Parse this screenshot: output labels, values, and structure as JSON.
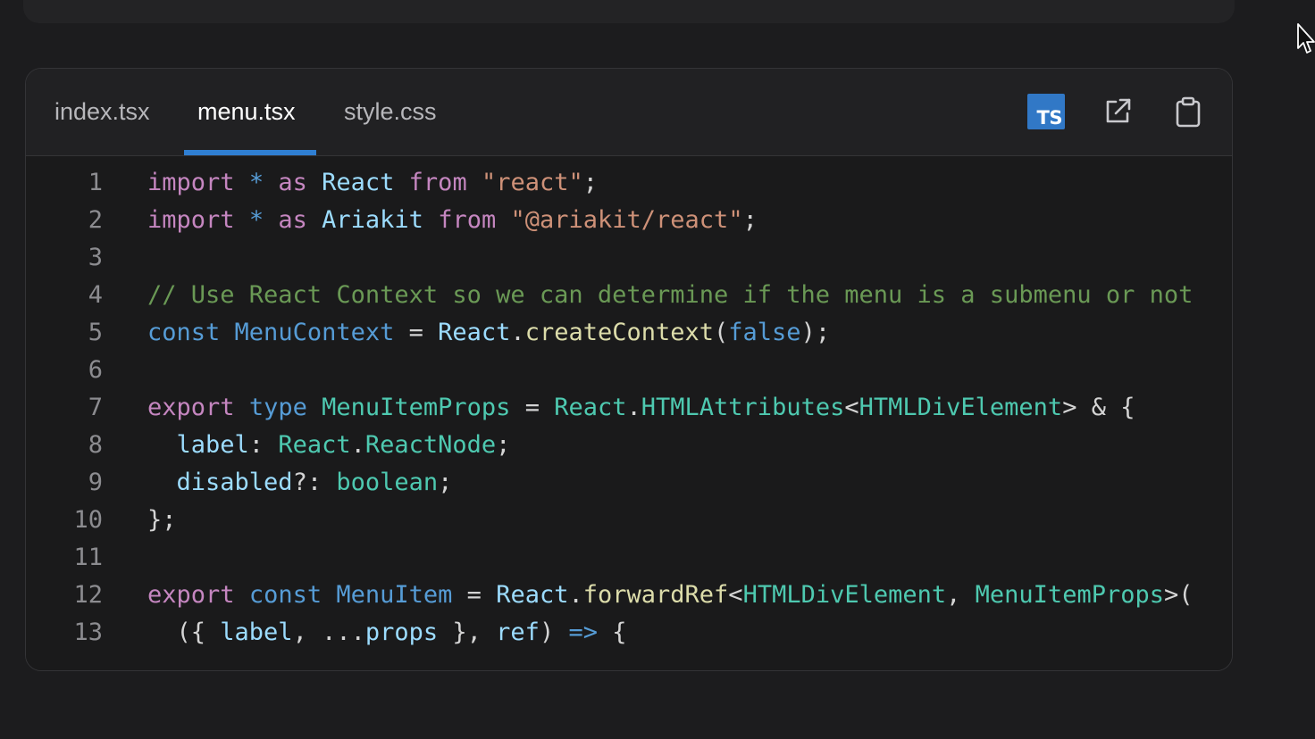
{
  "editor": {
    "tabs": [
      {
        "label": "index.tsx",
        "active": false
      },
      {
        "label": "menu.tsx",
        "active": true
      },
      {
        "label": "style.css",
        "active": false
      }
    ],
    "ts_badge": "TS",
    "icons": [
      "typescript-badge-icon",
      "open-external-icon",
      "clipboard-icon"
    ],
    "colors": {
      "keyword": "#c586c0",
      "declaration": "#569cd6",
      "identifier": "#9cdcfe",
      "type": "#4ec9b0",
      "function": "#dcdcaa",
      "string": "#ce9178",
      "comment": "#6a9955",
      "plain": "#d4d4d4",
      "accent": "#2f7fd3"
    }
  },
  "code": {
    "lines": [
      {
        "n": "1",
        "tokens": [
          [
            "import",
            "keyword"
          ],
          [
            " ",
            "plain"
          ],
          [
            "*",
            "declaration"
          ],
          [
            " ",
            "plain"
          ],
          [
            "as",
            "keyword"
          ],
          [
            " ",
            "plain"
          ],
          [
            "React",
            "identifier"
          ],
          [
            " ",
            "plain"
          ],
          [
            "from",
            "keyword"
          ],
          [
            " ",
            "plain"
          ],
          [
            "\"react\"",
            "string"
          ],
          [
            ";",
            "plain"
          ]
        ]
      },
      {
        "n": "2",
        "tokens": [
          [
            "import",
            "keyword"
          ],
          [
            " ",
            "plain"
          ],
          [
            "*",
            "declaration"
          ],
          [
            " ",
            "plain"
          ],
          [
            "as",
            "keyword"
          ],
          [
            " ",
            "plain"
          ],
          [
            "Ariakit",
            "identifier"
          ],
          [
            " ",
            "plain"
          ],
          [
            "from",
            "keyword"
          ],
          [
            " ",
            "plain"
          ],
          [
            "\"@ariakit/react\"",
            "string"
          ],
          [
            ";",
            "plain"
          ]
        ]
      },
      {
        "n": "3",
        "tokens": []
      },
      {
        "n": "4",
        "tokens": [
          [
            "// Use React Context so we can determine if the menu is a submenu or not",
            "comment"
          ]
        ]
      },
      {
        "n": "5",
        "tokens": [
          [
            "const",
            "declaration"
          ],
          [
            " ",
            "plain"
          ],
          [
            "MenuContext",
            "declaration"
          ],
          [
            " = ",
            "plain"
          ],
          [
            "React",
            "identifier"
          ],
          [
            ".",
            "plain"
          ],
          [
            "createContext",
            "function"
          ],
          [
            "(",
            "plain"
          ],
          [
            "false",
            "declaration"
          ],
          [
            ");",
            "plain"
          ]
        ]
      },
      {
        "n": "6",
        "tokens": []
      },
      {
        "n": "7",
        "tokens": [
          [
            "export",
            "keyword"
          ],
          [
            " ",
            "plain"
          ],
          [
            "type",
            "declaration"
          ],
          [
            " ",
            "plain"
          ],
          [
            "MenuItemProps",
            "type"
          ],
          [
            " = ",
            "plain"
          ],
          [
            "React",
            "type"
          ],
          [
            ".",
            "plain"
          ],
          [
            "HTMLAttributes",
            "type"
          ],
          [
            "<",
            "plain"
          ],
          [
            "HTMLDivElement",
            "type"
          ],
          [
            "> & {",
            "plain"
          ]
        ]
      },
      {
        "n": "8",
        "tokens": [
          [
            "  ",
            "plain"
          ],
          [
            "label",
            "identifier"
          ],
          [
            ": ",
            "plain"
          ],
          [
            "React",
            "type"
          ],
          [
            ".",
            "plain"
          ],
          [
            "ReactNode",
            "type"
          ],
          [
            ";",
            "plain"
          ]
        ]
      },
      {
        "n": "9",
        "tokens": [
          [
            "  ",
            "plain"
          ],
          [
            "disabled",
            "identifier"
          ],
          [
            "?: ",
            "plain"
          ],
          [
            "boolean",
            "type"
          ],
          [
            ";",
            "plain"
          ]
        ]
      },
      {
        "n": "10",
        "tokens": [
          [
            "};",
            "plain"
          ]
        ]
      },
      {
        "n": "11",
        "tokens": []
      },
      {
        "n": "12",
        "tokens": [
          [
            "export",
            "keyword"
          ],
          [
            " ",
            "plain"
          ],
          [
            "const",
            "declaration"
          ],
          [
            " ",
            "plain"
          ],
          [
            "MenuItem",
            "declaration"
          ],
          [
            " = ",
            "plain"
          ],
          [
            "React",
            "identifier"
          ],
          [
            ".",
            "plain"
          ],
          [
            "forwardRef",
            "function"
          ],
          [
            "<",
            "plain"
          ],
          [
            "HTMLDivElement",
            "type"
          ],
          [
            ", ",
            "plain"
          ],
          [
            "MenuItemProps",
            "type"
          ],
          [
            ">(",
            "plain"
          ]
        ]
      },
      {
        "n": "13",
        "tokens": [
          [
            "  ({ ",
            "plain"
          ],
          [
            "label",
            "identifier"
          ],
          [
            ", ...",
            "plain"
          ],
          [
            "props",
            "identifier"
          ],
          [
            " }, ",
            "plain"
          ],
          [
            "ref",
            "identifier"
          ],
          [
            ") ",
            "plain"
          ],
          [
            "=>",
            "declaration"
          ],
          [
            " {",
            "plain"
          ]
        ]
      }
    ]
  }
}
